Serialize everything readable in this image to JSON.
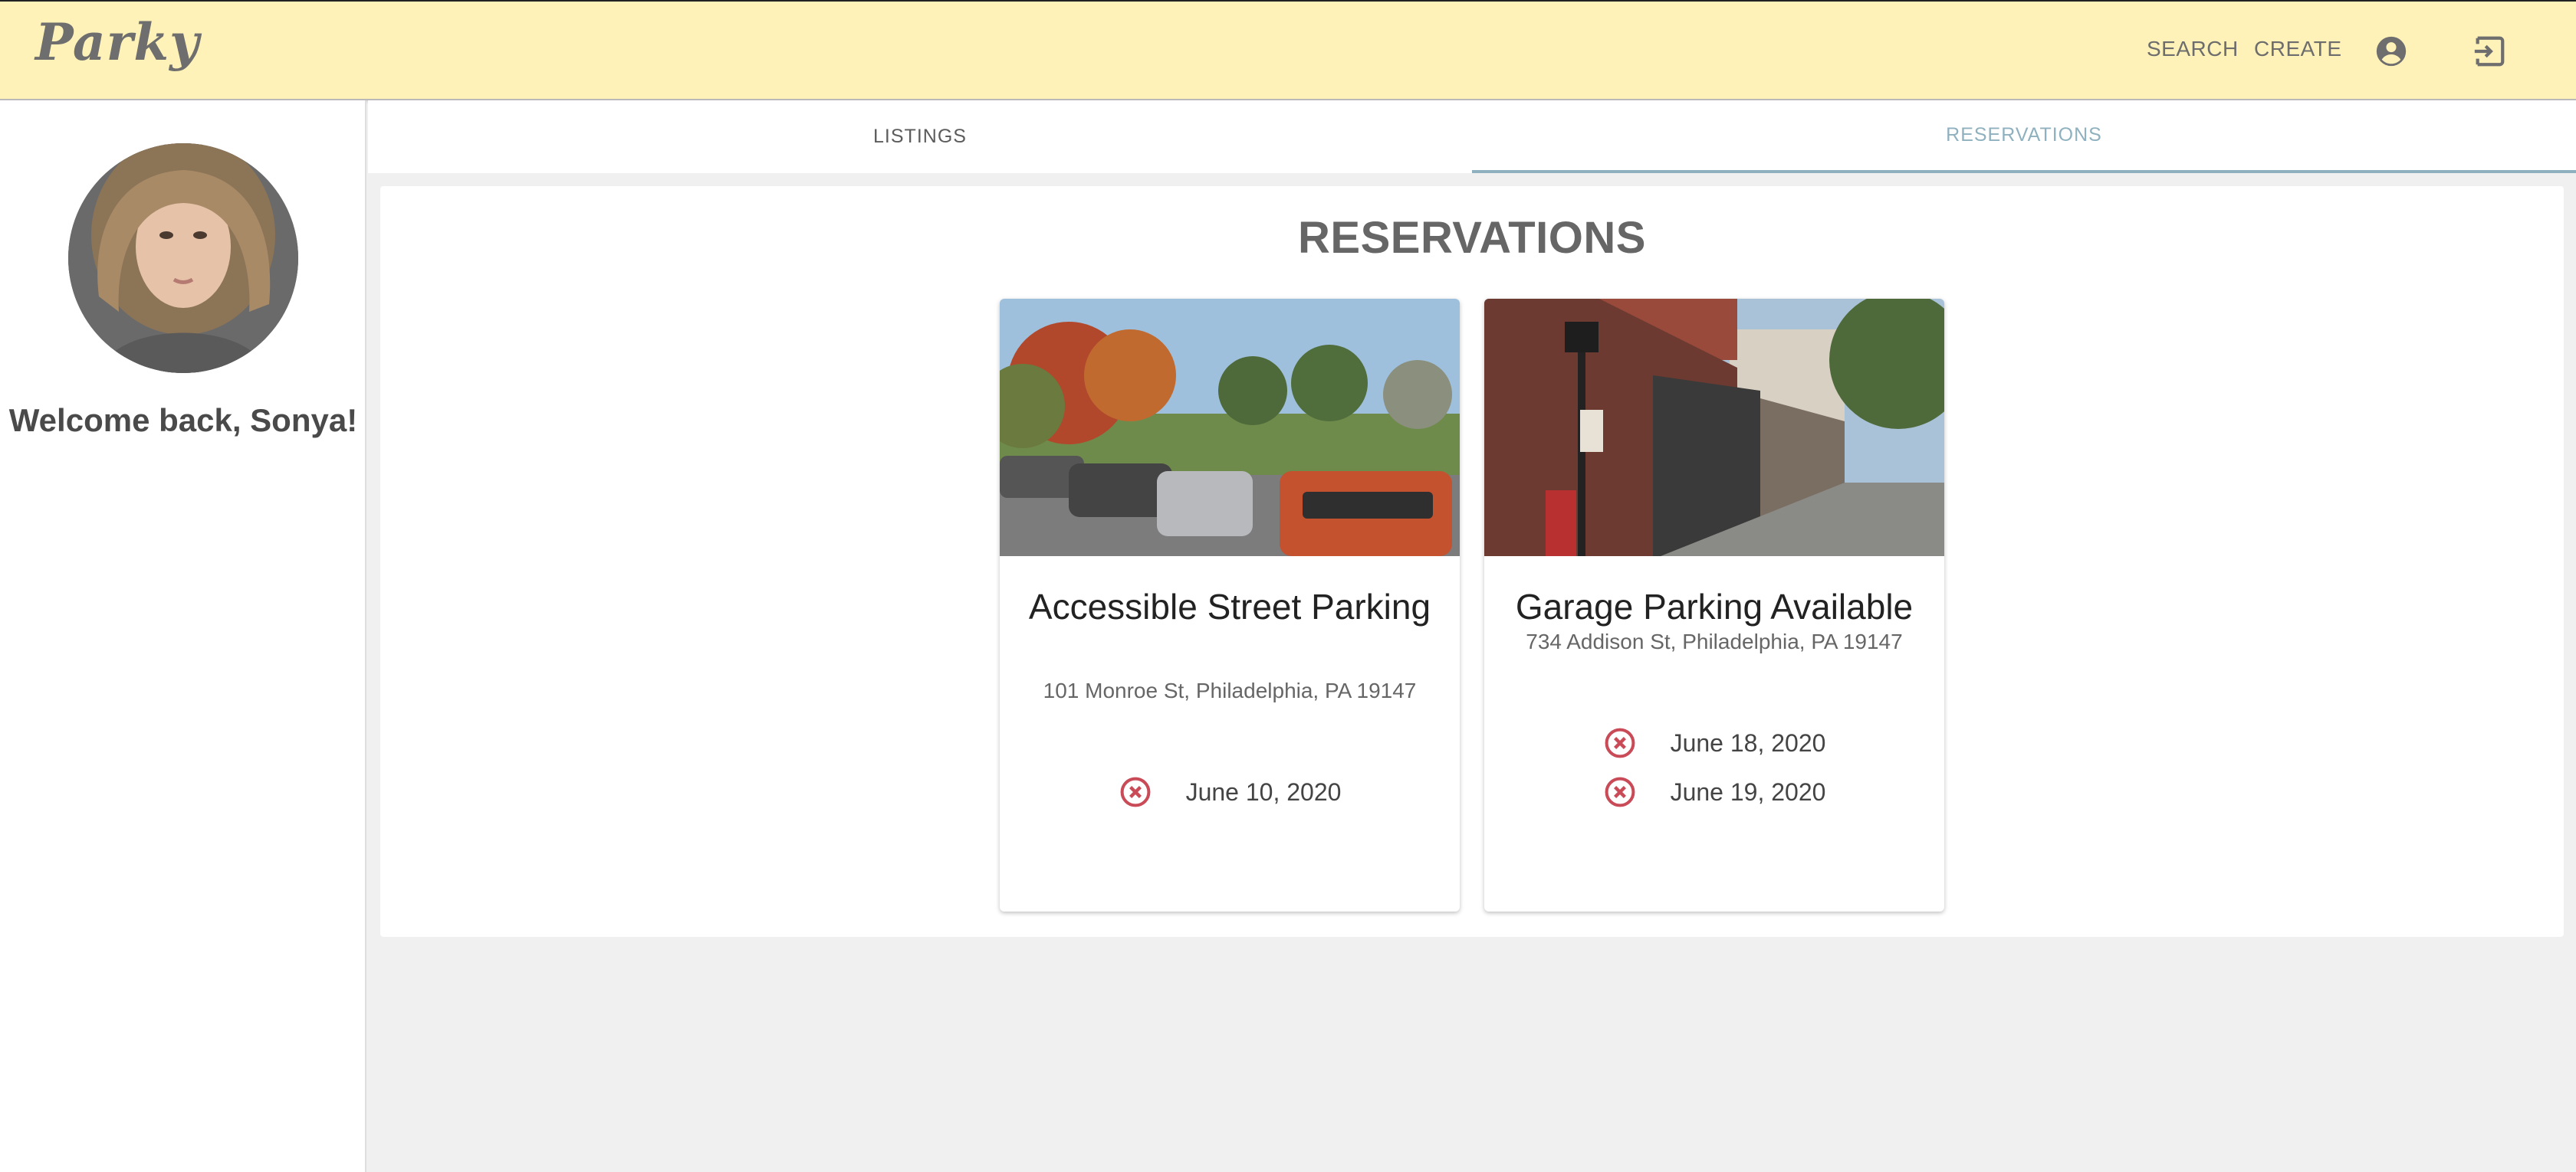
{
  "header": {
    "logo": "Parky",
    "nav": {
      "search": "SEARCH",
      "create": "CREATE"
    },
    "icons": {
      "account": "account-circle-icon",
      "logout": "exit-to-app-icon"
    },
    "bg_color": "#fff2b8"
  },
  "sidebar": {
    "welcome": "Welcome back, Sonya!"
  },
  "tabs": {
    "listings": "LISTINGS",
    "reservations": "RESERVATIONS",
    "active": "reservations",
    "active_color": "#8fb1bf"
  },
  "main": {
    "title": "RESERVATIONS",
    "cards": [
      {
        "title": "Accessible Street Parking",
        "address": "101 Monroe St, Philadelphia, PA 19147",
        "dates": [
          "June 10, 2020"
        ]
      },
      {
        "title": "Garage Parking Available",
        "address": "734 Addison St, Philadelphia, PA 19147",
        "dates": [
          "June 18, 2020",
          "June 19, 2020"
        ]
      }
    ],
    "cancel_icon_color": "#c94b57"
  }
}
